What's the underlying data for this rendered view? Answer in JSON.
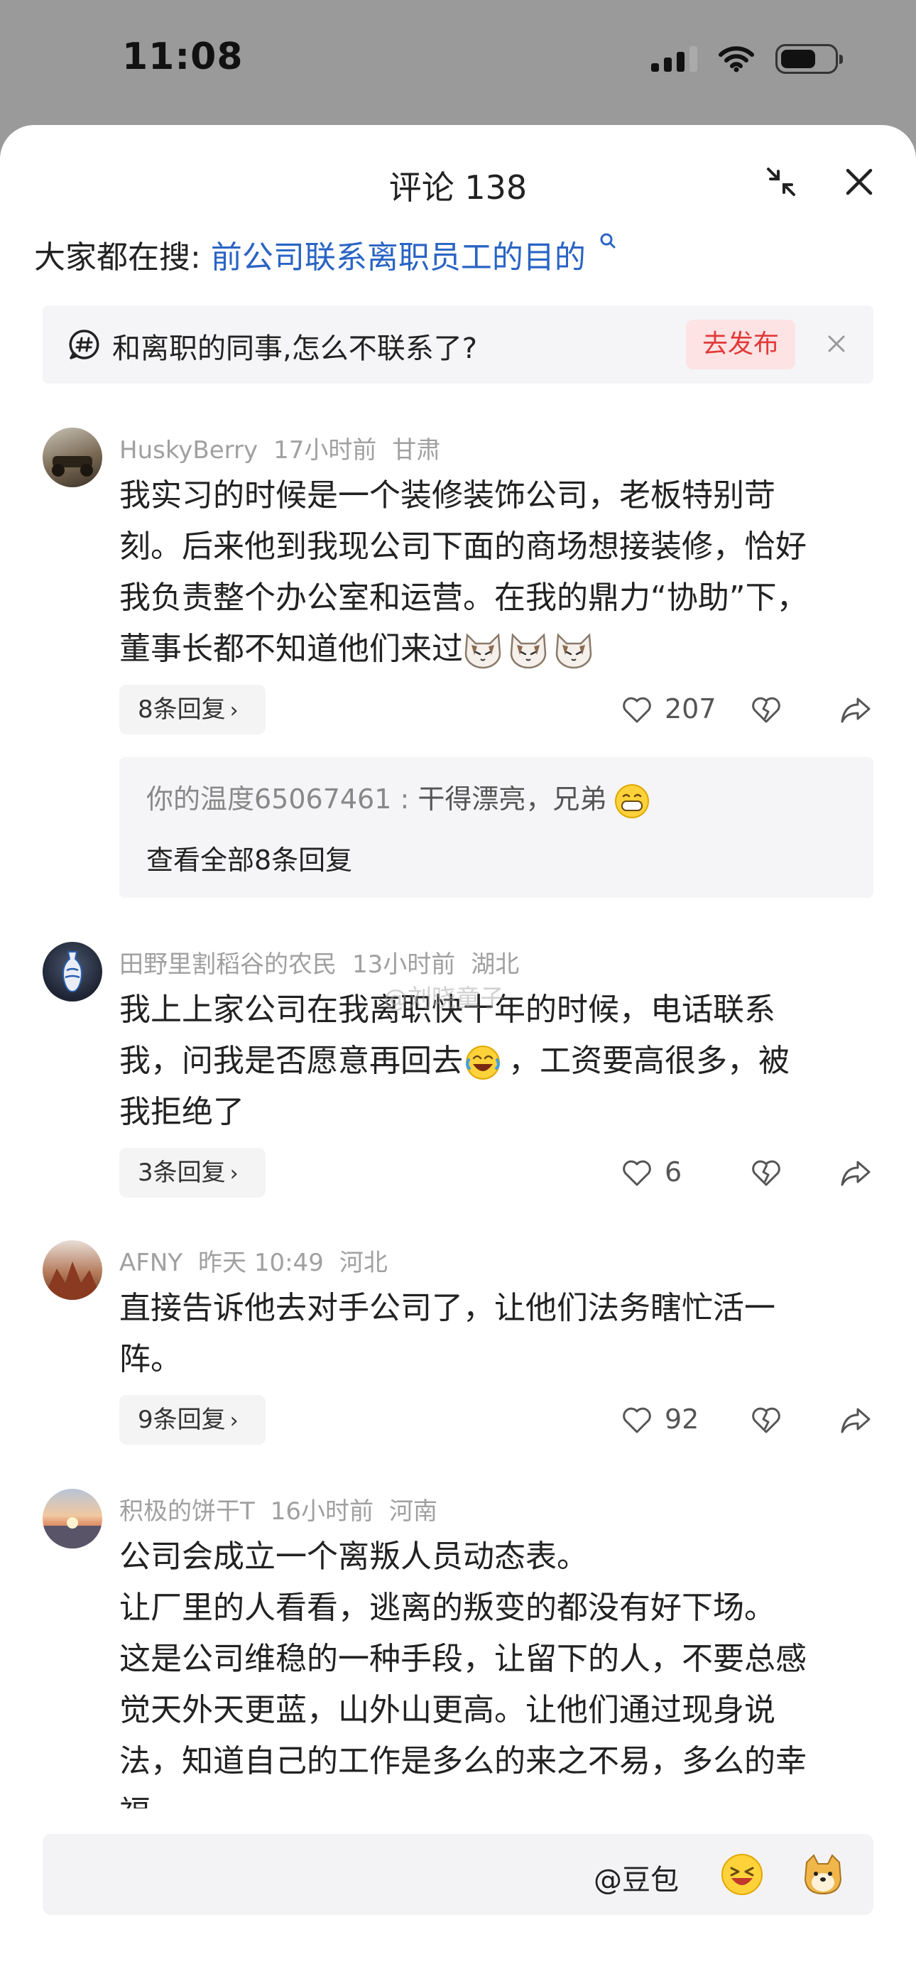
{
  "status": {
    "time": "11:08"
  },
  "header": {
    "title": "评论 138"
  },
  "search": {
    "prefix": "大家都在搜:",
    "query": "前公司联系离职员工的目的"
  },
  "topic": {
    "text": "和离职的同事,怎么不联系了?",
    "publish": "去发布"
  },
  "watermark": "@刘晓童子",
  "comments": [
    {
      "user": "HuskyBerry",
      "time": "17小时前",
      "location": "甘肃",
      "lines": [
        "我实习的时候是一个装修装饰公司，老板特别苛",
        "刻。后来他到我现公司下面的商场想接装修，恰好",
        "我负责整个办公室和运营。在我的鼎力“协助”下，",
        "董事长都不知道他们来过"
      ],
      "replies": "8条回复",
      "likes": "207",
      "reply_preview": {
        "user": "你的温度65067461 : ",
        "text": "干得漂亮，兄弟",
        "view_all": "查看全部8条回复"
      }
    },
    {
      "user": "田野里割稻谷的农民",
      "time": "13小时前",
      "location": "湖北",
      "lines": [
        "我上上家公司在我离职快十年的时候，电话联系",
        "我，问我是否愿意再回去",
        "我拒绝了"
      ],
      "line2_tail": "，工资要高很多，被",
      "replies": "3条回复",
      "likes": "6"
    },
    {
      "user": "AFNY",
      "time": "昨天 10:49",
      "location": "河北",
      "lines": [
        "直接告诉他去对手公司了，让他们法务瞎忙活一",
        "阵。"
      ],
      "replies": "9条回复",
      "likes": "92"
    },
    {
      "user": "积极的饼干T",
      "time": "16小时前",
      "location": "河南",
      "lines": [
        "公司会成立一个离叛人员动态表。",
        "让厂里的人看看，逃离的叛变的都没有好下场。",
        "这是公司维稳的一种手段，让留下的人，不要总感",
        "觉天外天更蓝，山外山更高。让他们通过现身说",
        "法，知道自己的工作是多么的来之不易，多么的幸",
        "福"
      ]
    }
  ],
  "input": {
    "mention": "@豆包"
  },
  "icons": [
    "collapse-icon",
    "close-icon",
    "search-icon",
    "topic-hashtag-icon",
    "heart-icon",
    "dislike-heart-icon",
    "share-icon"
  ],
  "colors": {
    "link": "#2a64c4",
    "publish_text": "#e23a3a",
    "publish_bg": "#fde3e3",
    "meta": "#a0a0a0"
  }
}
